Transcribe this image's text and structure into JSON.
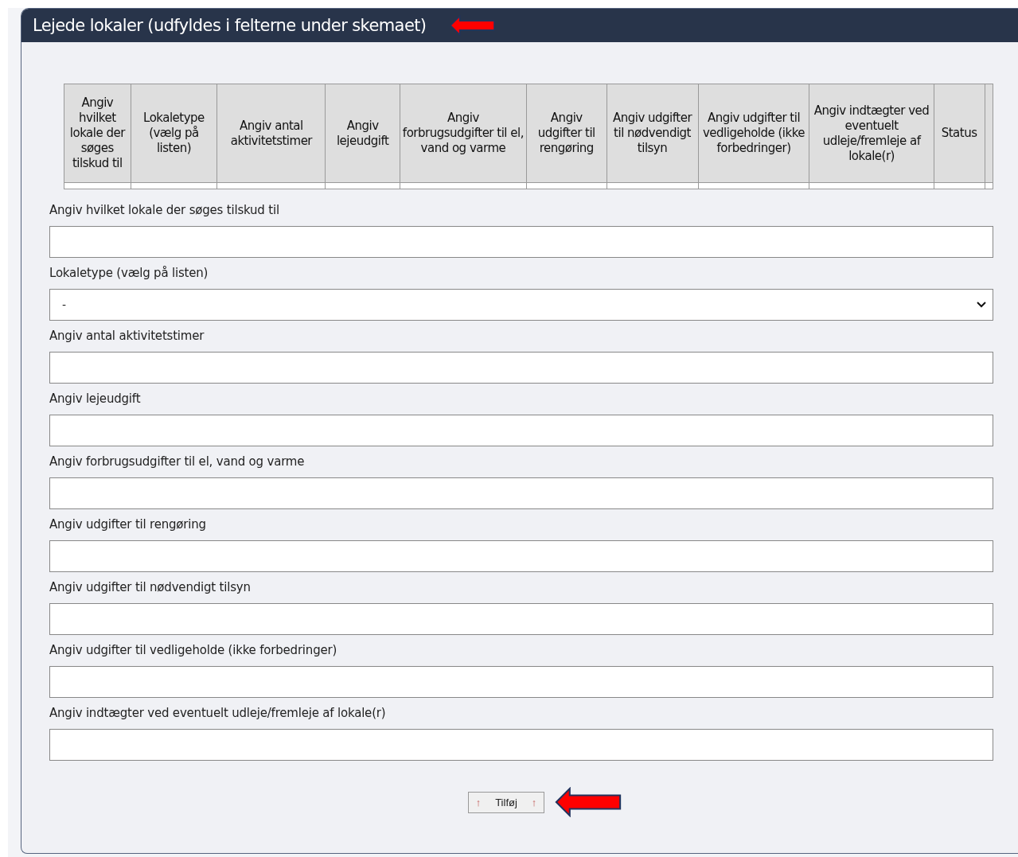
{
  "panel": {
    "title": "Lejede lokaler (udfyldes i felterne under skemaet)"
  },
  "table": {
    "columns": [
      "Angiv hvilket lokale der søges tilskud til",
      "Lokaletype (vælg på listen)",
      "Angiv antal aktivitetstimer",
      "Angiv lejeudgift",
      "Angiv forbrugsudgifter til el, vand og varme",
      "Angiv udgifter til rengøring",
      "Angiv udgifter til nødvendigt tilsyn",
      "Angiv udgifter til vedligeholde (ikke forbedringer)",
      "Angiv indtægter ved eventuelt udleje/fremleje af lokale(r)",
      "Status"
    ]
  },
  "fields": [
    {
      "label": "Angiv hvilket lokale der søges tilskud til",
      "kind": "text"
    },
    {
      "label": "Lokaletype (vælg på listen)",
      "kind": "select",
      "value": "-"
    },
    {
      "label": "Angiv antal aktivitetstimer",
      "kind": "text"
    },
    {
      "label": "Angiv lejeudgift",
      "kind": "text"
    },
    {
      "label": "Angiv forbrugsudgifter til el, vand og varme",
      "kind": "text"
    },
    {
      "label": "Angiv udgifter til rengøring",
      "kind": "text"
    },
    {
      "label": "Angiv udgifter til nødvendigt tilsyn",
      "kind": "text"
    },
    {
      "label": "Angiv udgifter til vedligeholde (ikke forbedringer)",
      "kind": "text"
    },
    {
      "label": "Angiv indtægter ved eventuelt udleje/fremleje af lokale(r)",
      "kind": "text"
    }
  ],
  "add_button": {
    "icon_left": "↑",
    "label": "Tilføj",
    "icon_right": "↑"
  }
}
